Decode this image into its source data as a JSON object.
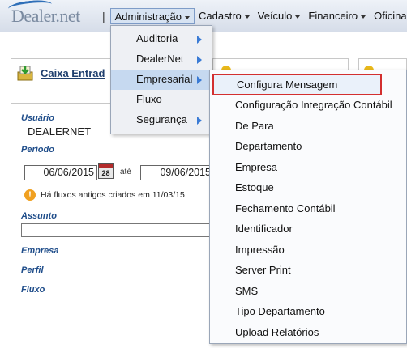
{
  "header": {
    "logo_text": "Dealer.net",
    "separator": "|",
    "menus": [
      {
        "label": "Administração"
      },
      {
        "label": "Cadastro"
      },
      {
        "label": "Veículo"
      },
      {
        "label": "Financeiro"
      },
      {
        "label": "Oficina"
      }
    ]
  },
  "tabs": {
    "first_title": "Caixa Entrad"
  },
  "form": {
    "usuario_label": "Usuário",
    "usuario_value": "DEALERNET",
    "periodo_label": "Período",
    "date_from": "06/06/2015",
    "calendar_day": "28",
    "ate_label": "até",
    "date_to": "09/06/2015",
    "warning_icon_text": "!",
    "warning_text": "Há fluxos antigos criados em 11/03/15",
    "assunto_label": "Assunto",
    "empresa_label": "Empresa",
    "perfil_label": "Perfil",
    "fluxo_label": "Fluxo"
  },
  "admin_menu": {
    "items": [
      {
        "label": "Auditoria"
      },
      {
        "label": "DealerNet"
      },
      {
        "label": "Empresarial"
      },
      {
        "label": "Fluxo"
      },
      {
        "label": "Segurança"
      }
    ]
  },
  "empresarial_menu": {
    "items": [
      {
        "label": "Configura Mensagem"
      },
      {
        "label": "Configuração Integração Contábil"
      },
      {
        "label": "De Para"
      },
      {
        "label": "Departamento"
      },
      {
        "label": "Empresa"
      },
      {
        "label": "Estoque"
      },
      {
        "label": "Fechamento Contábil"
      },
      {
        "label": "Identificador"
      },
      {
        "label": "Impressão"
      },
      {
        "label": "Server Print"
      },
      {
        "label": "SMS"
      },
      {
        "label": "Tipo Departamento"
      },
      {
        "label": "Upload Relatórios"
      }
    ]
  },
  "colors": {
    "highlight_border": "#d32f2f",
    "menu_hover": "#c6d9f0",
    "arrow": "#3a7bd5",
    "label_blue": "#1f4d8a"
  }
}
